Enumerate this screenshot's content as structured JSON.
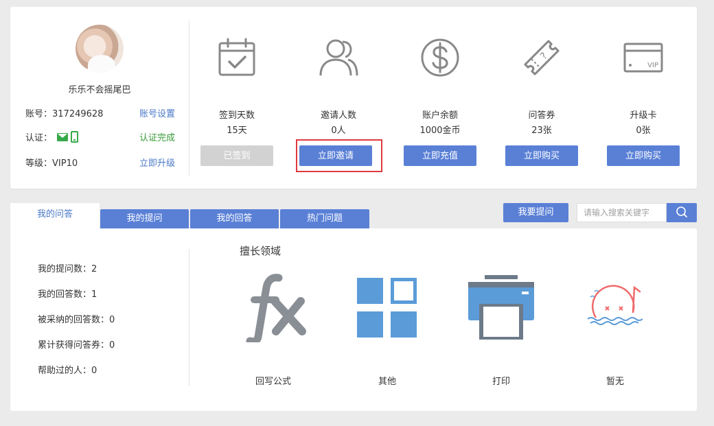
{
  "profile": {
    "username": "乐乐不会摇尾巴",
    "account_label": "账号：317249628",
    "account_action": "账号设置",
    "cert_label": "认证：",
    "cert_action": "认证完成",
    "level_label": "等级：VIP10",
    "level_action": "立即升级"
  },
  "stats": [
    {
      "title": "签到天数",
      "value": "15天",
      "button": "已签到",
      "icon": "calendar-check-icon"
    },
    {
      "title": "邀请人数",
      "value": "0人",
      "button": "立即邀请",
      "icon": "users-icon"
    },
    {
      "title": "账户余额",
      "value": "1000金币",
      "button": "立即充值",
      "icon": "dollar-coin-icon"
    },
    {
      "title": "问答券",
      "value": "23张",
      "button": "立即购买",
      "icon": "ticket-icon"
    },
    {
      "title": "升级卡",
      "value": "0张",
      "button": "立即购买",
      "icon": "vip-card-icon"
    }
  ],
  "tabs": [
    "我的问答",
    "我的提问",
    "我的回答",
    "热门问题"
  ],
  "ask_button": "我要提问",
  "search": {
    "placeholder": "请输入搜索关键字"
  },
  "qa_stats": [
    "我的提问数：2",
    "我的回答数：1",
    "被采纳的回答数：0",
    "累计获得问答券：0",
    "帮助过的人：0"
  ],
  "expertise": {
    "title": "擅长领域",
    "items": [
      {
        "label": "回写公式",
        "icon": "formula-fx-icon"
      },
      {
        "label": "其他",
        "icon": "grid-icon"
      },
      {
        "label": "打印",
        "icon": "printer-icon"
      },
      {
        "label": "暂无",
        "icon": "empty-face-icon"
      }
    ]
  },
  "colors": {
    "accent": "#5a80d6",
    "link_blue": "#4a78c6",
    "link_green": "#3a9a3a",
    "highlight": "#e0393e"
  }
}
